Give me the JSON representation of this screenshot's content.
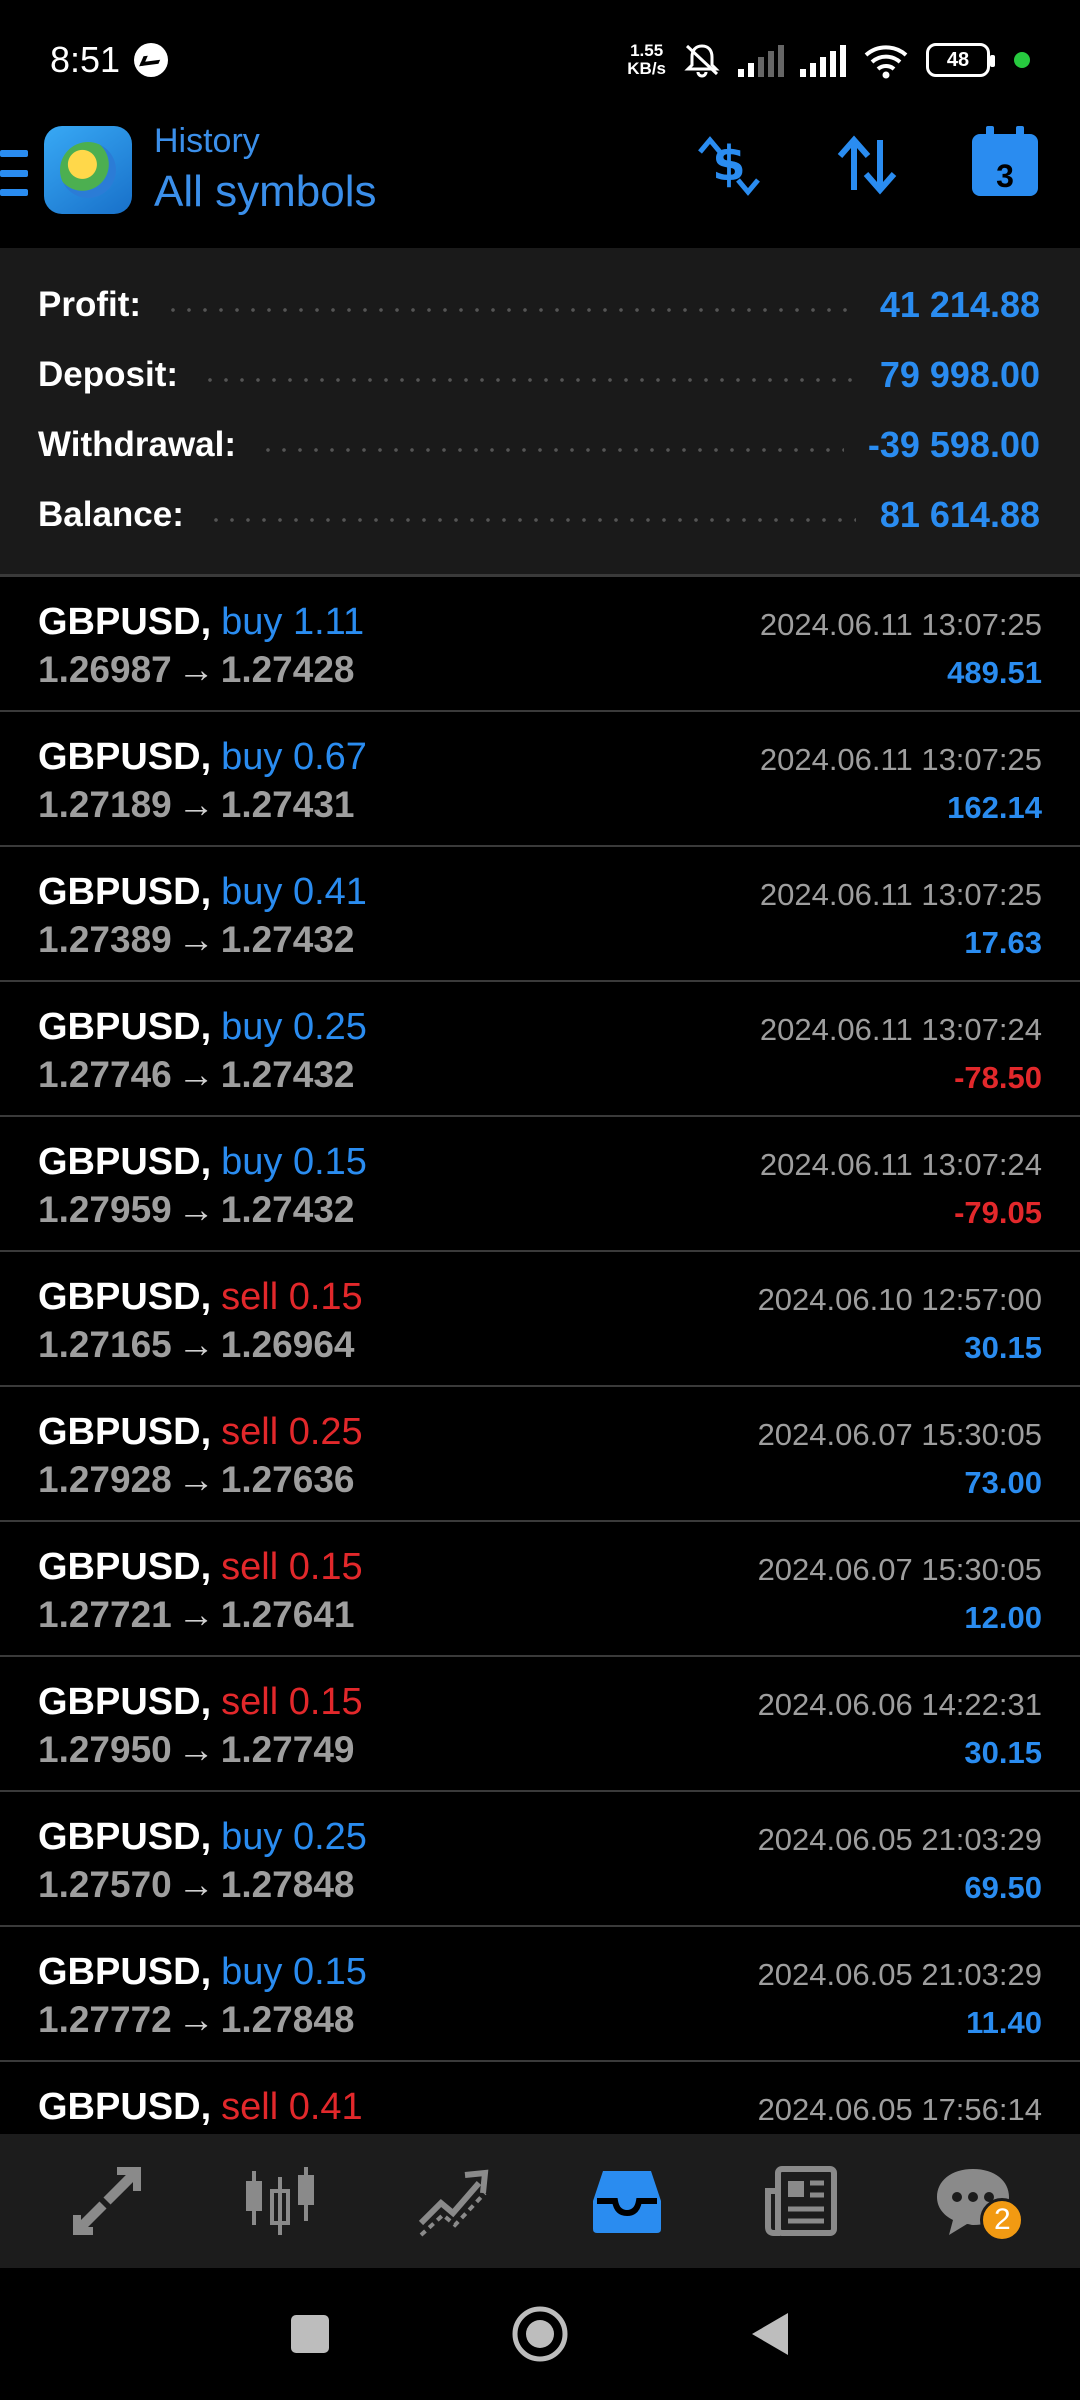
{
  "status_bar": {
    "time": "8:51",
    "net_speed_value": "1.55",
    "net_speed_unit": "KB/s",
    "battery": "48"
  },
  "header": {
    "subtitle": "History",
    "title": "All symbols",
    "calendar_day": "3"
  },
  "summary": {
    "profit_label": "Profit:",
    "profit_value": "41 214.88",
    "deposit_label": "Deposit:",
    "deposit_value": "79 998.00",
    "withdrawal_label": "Withdrawal:",
    "withdrawal_value": "-39 598.00",
    "balance_label": "Balance:",
    "balance_value": "81 614.88"
  },
  "deals": [
    {
      "symbol": "GBPUSD,",
      "direction": "buy 1.11",
      "type": "buy",
      "open": "1.26987",
      "close": "1.27428",
      "time": "2024.06.11 13:07:25",
      "profit": "489.51",
      "sign": "pos"
    },
    {
      "symbol": "GBPUSD,",
      "direction": "buy 0.67",
      "type": "buy",
      "open": "1.27189",
      "close": "1.27431",
      "time": "2024.06.11 13:07:25",
      "profit": "162.14",
      "sign": "pos"
    },
    {
      "symbol": "GBPUSD,",
      "direction": "buy 0.41",
      "type": "buy",
      "open": "1.27389",
      "close": "1.27432",
      "time": "2024.06.11 13:07:25",
      "profit": "17.63",
      "sign": "pos"
    },
    {
      "symbol": "GBPUSD,",
      "direction": "buy 0.25",
      "type": "buy",
      "open": "1.27746",
      "close": "1.27432",
      "time": "2024.06.11 13:07:24",
      "profit": "-78.50",
      "sign": "neg"
    },
    {
      "symbol": "GBPUSD,",
      "direction": "buy 0.15",
      "type": "buy",
      "open": "1.27959",
      "close": "1.27432",
      "time": "2024.06.11 13:07:24",
      "profit": "-79.05",
      "sign": "neg"
    },
    {
      "symbol": "GBPUSD,",
      "direction": "sell 0.15",
      "type": "sell",
      "open": "1.27165",
      "close": "1.26964",
      "time": "2024.06.10 12:57:00",
      "profit": "30.15",
      "sign": "pos"
    },
    {
      "symbol": "GBPUSD,",
      "direction": "sell 0.25",
      "type": "sell",
      "open": "1.27928",
      "close": "1.27636",
      "time": "2024.06.07 15:30:05",
      "profit": "73.00",
      "sign": "pos"
    },
    {
      "symbol": "GBPUSD,",
      "direction": "sell 0.15",
      "type": "sell",
      "open": "1.27721",
      "close": "1.27641",
      "time": "2024.06.07 15:30:05",
      "profit": "12.00",
      "sign": "pos"
    },
    {
      "symbol": "GBPUSD,",
      "direction": "sell 0.15",
      "type": "sell",
      "open": "1.27950",
      "close": "1.27749",
      "time": "2024.06.06 14:22:31",
      "profit": "30.15",
      "sign": "pos"
    },
    {
      "symbol": "GBPUSD,",
      "direction": "buy 0.25",
      "type": "buy",
      "open": "1.27570",
      "close": "1.27848",
      "time": "2024.06.05 21:03:29",
      "profit": "69.50",
      "sign": "pos"
    },
    {
      "symbol": "GBPUSD,",
      "direction": "buy 0.15",
      "type": "buy",
      "open": "1.27772",
      "close": "1.27848",
      "time": "2024.06.05 21:03:29",
      "profit": "11.40",
      "sign": "pos"
    },
    {
      "symbol": "GBPUSD,",
      "direction": "sell 0.41",
      "type": "sell",
      "open": "",
      "close": "",
      "time": "2024.06.05 17:56:14",
      "profit": "",
      "sign": "pos"
    }
  ],
  "arrow": "→",
  "bottom_nav": {
    "items": [
      "quotes-icon",
      "chart-icon",
      "trade-icon",
      "history-icon",
      "news-icon",
      "messages-icon"
    ],
    "active_index": 3,
    "messages_badge": "2"
  },
  "colors": {
    "accent": "#2a8cf0",
    "negative": "#e2282b",
    "summary_bg": "#1a1a1a",
    "nav_bg": "#1c1c1c",
    "badge": "#f29a12"
  }
}
